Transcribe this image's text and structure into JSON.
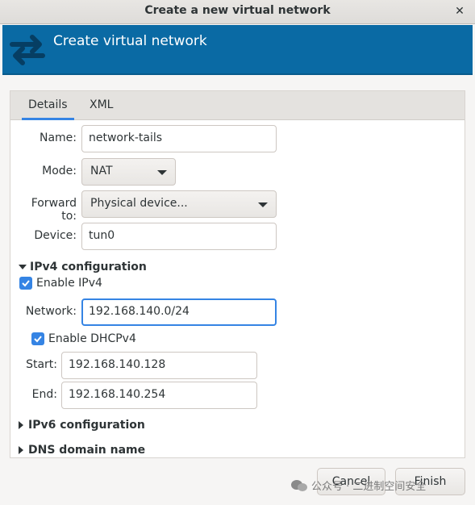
{
  "window": {
    "title": "Create a new virtual network",
    "close_glyph": "✕"
  },
  "banner": {
    "title": "Create virtual network",
    "icon": "network-arrows-icon"
  },
  "tabs": [
    {
      "label": "Details",
      "active": true
    },
    {
      "label": "XML",
      "active": false
    }
  ],
  "form": {
    "name_label": "Name:",
    "name_value": "network-tails",
    "mode_label": "Mode:",
    "mode_value": "NAT",
    "forward_label": "Forward to:",
    "forward_value": "Physical device...",
    "device_label": "Device:",
    "device_value": "tun0"
  },
  "ipv4": {
    "header": "IPv4 configuration",
    "enable_label": "Enable IPv4",
    "enabled": true,
    "network_label": "Network:",
    "network_value": "192.168.140.0/24",
    "dhcp_label": "Enable DHCPv4",
    "dhcp_enabled": true,
    "start_label": "Start:",
    "start_value": "192.168.140.128",
    "end_label": "End:",
    "end_value": "192.168.140.254"
  },
  "ipv6": {
    "header": "IPv6 configuration"
  },
  "dns": {
    "header": "DNS domain name"
  },
  "buttons": {
    "cancel": "Cancel",
    "finish": "Finish"
  },
  "watermark": {
    "text": "公众号 · 二进制空间安全"
  },
  "colors": {
    "banner": "#0a6aa4",
    "accent": "#3584e4",
    "window_bg": "#f6f5f4"
  }
}
